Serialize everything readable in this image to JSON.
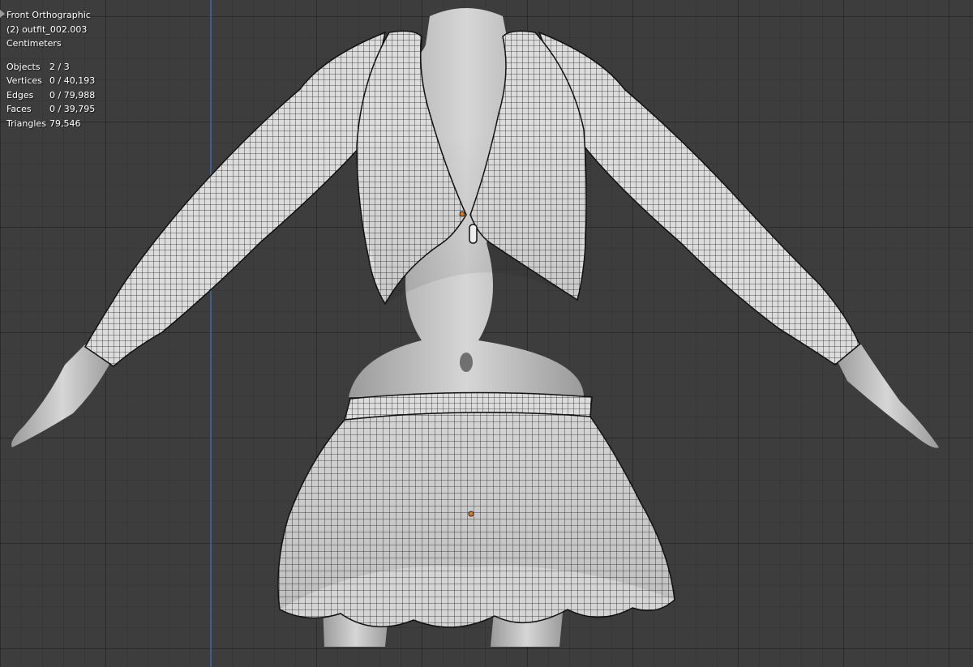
{
  "viewport": {
    "view_name": "Front Orthographic",
    "object_label": "(2) outfit_002.003",
    "units": "Centimeters",
    "stats": [
      {
        "label": "Objects",
        "value": "2 / 3"
      },
      {
        "label": "Vertices",
        "value": "0 / 40,193"
      },
      {
        "label": "Edges",
        "value": "0 / 79,988"
      },
      {
        "label": "Faces",
        "value": "0 / 39,795"
      },
      {
        "label": "Triangles",
        "value": "79,546"
      }
    ],
    "colors": {
      "background": "#3d3d3d",
      "grid": "#333333",
      "axis": "#3f5f86",
      "skin": "#c9c9c9",
      "cloth": "#d8d8d8",
      "wire": "#1a1a1a",
      "origin": "#e07a1f"
    }
  }
}
